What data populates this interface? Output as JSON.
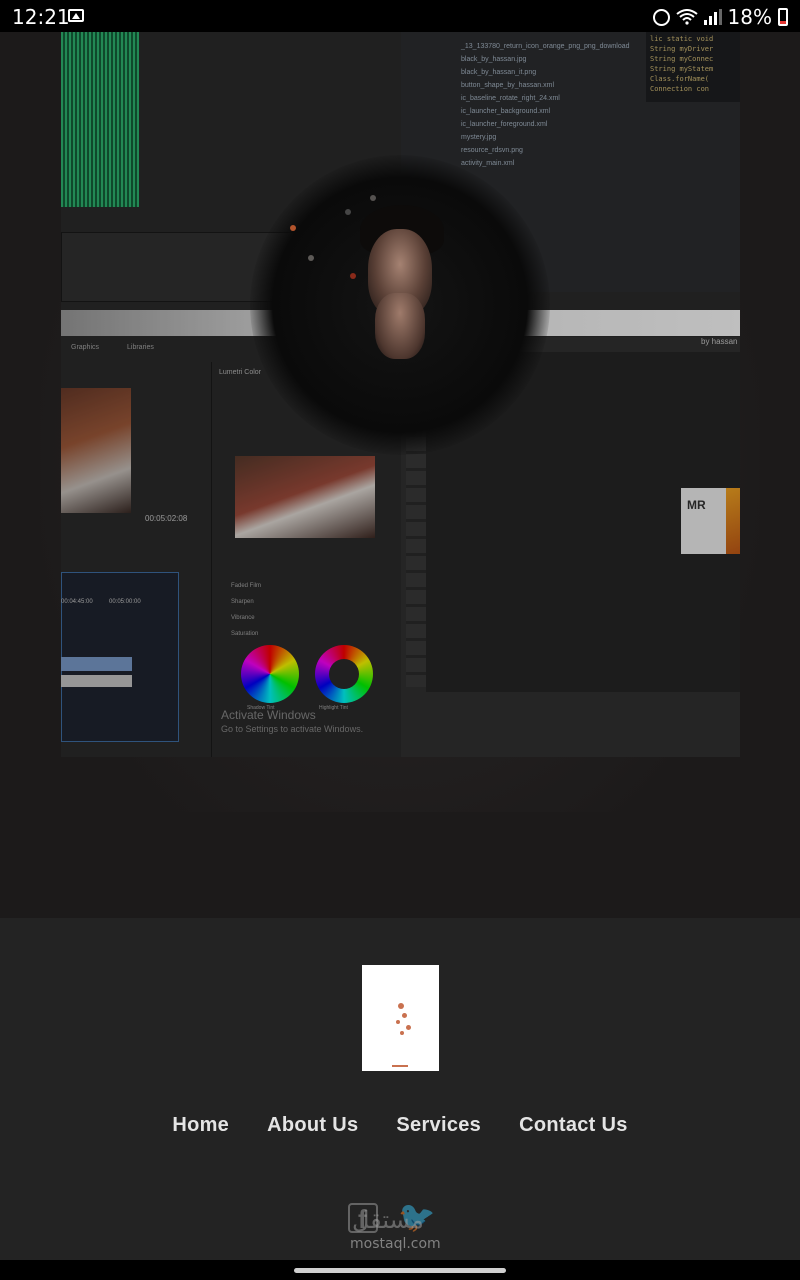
{
  "status_bar": {
    "time": "12:21",
    "battery": "18%",
    "icons": [
      "image-icon",
      "alarm-icon",
      "wifi-icon",
      "signal-icon",
      "battery-icon"
    ]
  },
  "hero": {
    "screenshot_texts": {
      "filelist": [
        "_13_133780_return_icon_orange_png_png_download",
        "black_by_hassan.jpg",
        "black_by_hassan_it.png",
        "button_shape_by_hassan.xml",
        "ic_baseline_rotate_right_24.xml",
        "ic_launcher_background.xml",
        "ic_launcher_foreground.xml",
        "mystery.jpg",
        "resource_rdsvn.png",
        "activity_main.xml"
      ],
      "code": [
        "lic static void",
        "String myDriver",
        "String myConnec",
        "String myStatem",
        "Class.forName(",
        "Connection con"
      ],
      "tabs": [
        "Graphics",
        "Libraries"
      ],
      "lumetri_title": "Lumetri Color",
      "adjustments": [
        "Faded Film",
        "Sharpen",
        "Vibrance",
        "Saturation"
      ],
      "wheel_labels": [
        "Shadow Tint",
        "Highlight Tint"
      ],
      "timecodes": [
        "00:05:02:08",
        "00:04:45:00",
        "00:05:00:00"
      ],
      "watermark_line1": "Activate Windows",
      "watermark_line2": "Go to Settings to activate Windows.",
      "ps_credit": "by hassan",
      "logo_letters": "MR"
    }
  },
  "footer": {
    "nav": [
      "Home",
      "About Us",
      "Services",
      "Contact Us"
    ],
    "social": [
      "facebook-icon",
      "twitter-icon"
    ],
    "watermark": "mostaql.com",
    "watermark_ar": "مستقل"
  }
}
